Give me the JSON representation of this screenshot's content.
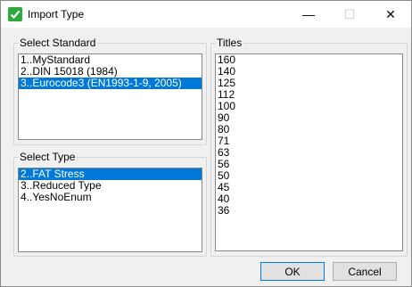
{
  "window": {
    "title": "Import Type",
    "minimize_glyph": "—",
    "maximize_glyph": "☐",
    "close_glyph": "✕"
  },
  "select_standard": {
    "label": "Select Standard",
    "items": [
      "1..MyStandard",
      "2..DIN 15018 (1984)",
      "3..Eurocode3 (EN1993-1-9, 2005)"
    ],
    "selected_index": 2
  },
  "select_type": {
    "label": "Select Type",
    "items": [
      "2..FAT Stress",
      "3..Reduced Type",
      "4..YesNoEnum"
    ],
    "selected_index": 0
  },
  "titles": {
    "label": "Titles",
    "items": [
      "160",
      "140",
      "125",
      "112",
      "100",
      "90",
      "80",
      "71",
      "63",
      "56",
      "50",
      "45",
      "40",
      "36"
    ]
  },
  "buttons": {
    "ok": "OK",
    "cancel": "Cancel"
  },
  "colors": {
    "selection": "#0078d7",
    "check_icon": "#2eaa3c"
  },
  "icons": {
    "app": "green-checkbox-icon"
  }
}
